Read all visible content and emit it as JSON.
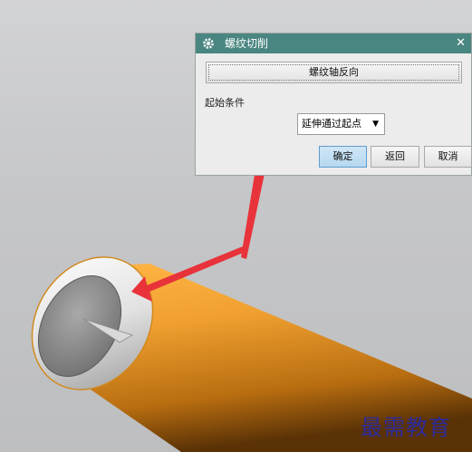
{
  "dialog": {
    "title": "螺纹切削",
    "close_glyph": "✕",
    "reverse_button_label": "螺纹轴反向",
    "section_label": "起始条件",
    "start_condition": {
      "selected": "延伸通过起点",
      "caret": "▼"
    },
    "ok_label": "确定",
    "back_label": "返回",
    "cancel_label": "取消"
  },
  "watermark": "最需教育",
  "colors": {
    "titlebar": "#4a8681",
    "cylinder": "#f0a030",
    "arrow": "#e8333a",
    "ok_button": "#b5d8f0"
  },
  "icons": {
    "title": "gear-icon"
  }
}
